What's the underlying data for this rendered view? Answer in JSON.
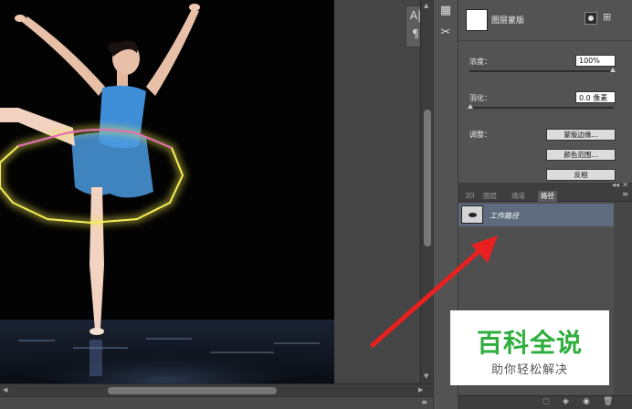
{
  "canvas": {
    "description_free": true
  },
  "mini_toolbar": {
    "char_glyph": "A|",
    "para_glyph": "¶"
  },
  "icon_strip": {
    "icons": [
      "history-icon",
      "tools-icon"
    ]
  },
  "properties": {
    "title": "图层蒙版",
    "density_label": "浓度：",
    "density_value": "100%",
    "feather_label": "羽化：",
    "feather_value": "0.0 像素",
    "adjust_label": "调整：",
    "mask_edge_button": "蒙版边缘...",
    "color_range_button": "颜色范围...",
    "invert_button": "反相"
  },
  "panel": {
    "tabs": [
      {
        "label": "3D",
        "active": false
      },
      {
        "label": "图层",
        "active": false
      },
      {
        "label": "通道",
        "active": false
      },
      {
        "label": "路径",
        "active": true
      }
    ],
    "collapse_glyph": "◂◂",
    "close_glyph": "✕",
    "menu_glyph": "≡",
    "paths": [
      {
        "name": "工作路径"
      }
    ]
  },
  "bottom_bar": {
    "icons": [
      "selection-icon",
      "mask-icon",
      "new-path-icon",
      "trash-icon"
    ]
  },
  "watermark": {
    "title": "百科全说",
    "subtitle": "助你轻松解决"
  },
  "colors": {
    "path_glow": "#f0e84a",
    "path_magenta": "#e050d0",
    "arrow": "#e82020",
    "watermark_green": "#2eae3c"
  }
}
